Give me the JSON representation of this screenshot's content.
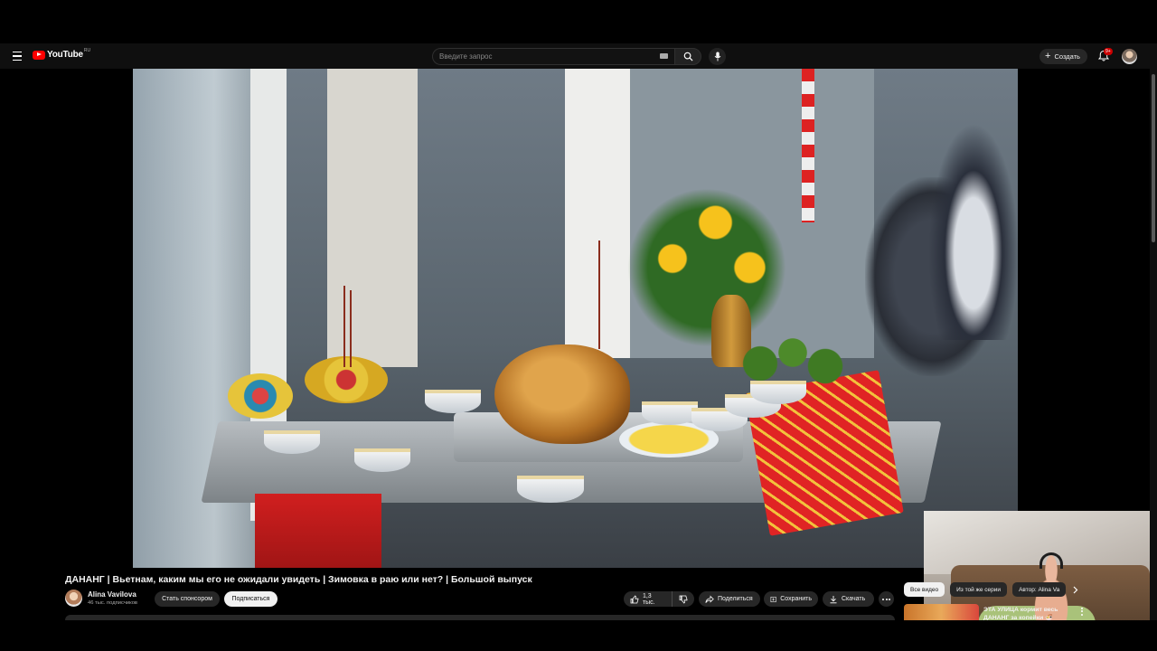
{
  "header": {
    "logo_text": "YouTube",
    "logo_region": "RU",
    "search_placeholder": "Введите запрос",
    "create_label": "Создать",
    "notifications_badge": "9+"
  },
  "video": {
    "title": "ДАНАНГ | Вьетнам, каким мы его не ожидали увидеть | Зимовка в раю или нет? | Большой выпуск"
  },
  "channel": {
    "name": "Alina Vavilova",
    "subscribers": "46 тыс. подписчиков",
    "sponsor_label": "Стать спонсором",
    "subscribe_label": "Подписаться"
  },
  "actions": {
    "likes": "1,3 тыс.",
    "share_label": "Поделиться",
    "save_label": "Сохранить",
    "download_label": "Скачать"
  },
  "sidebar": {
    "chips": [
      {
        "label": "Все видео",
        "active": true
      },
      {
        "label": "Из той же серии",
        "active": false
      },
      {
        "label": "Автор: Alina Va",
        "active": false
      }
    ],
    "recommendations": [
      {
        "title": "ЭТА УЛИЦА кормит весь ДАНАНГ за копейки 🍜"
      }
    ]
  },
  "colors": {
    "background": "#0f0f0f",
    "surface": "#272727",
    "brand_red": "#ff0000",
    "text_primary": "#f1f1f1",
    "text_secondary": "#aaaaaa"
  }
}
